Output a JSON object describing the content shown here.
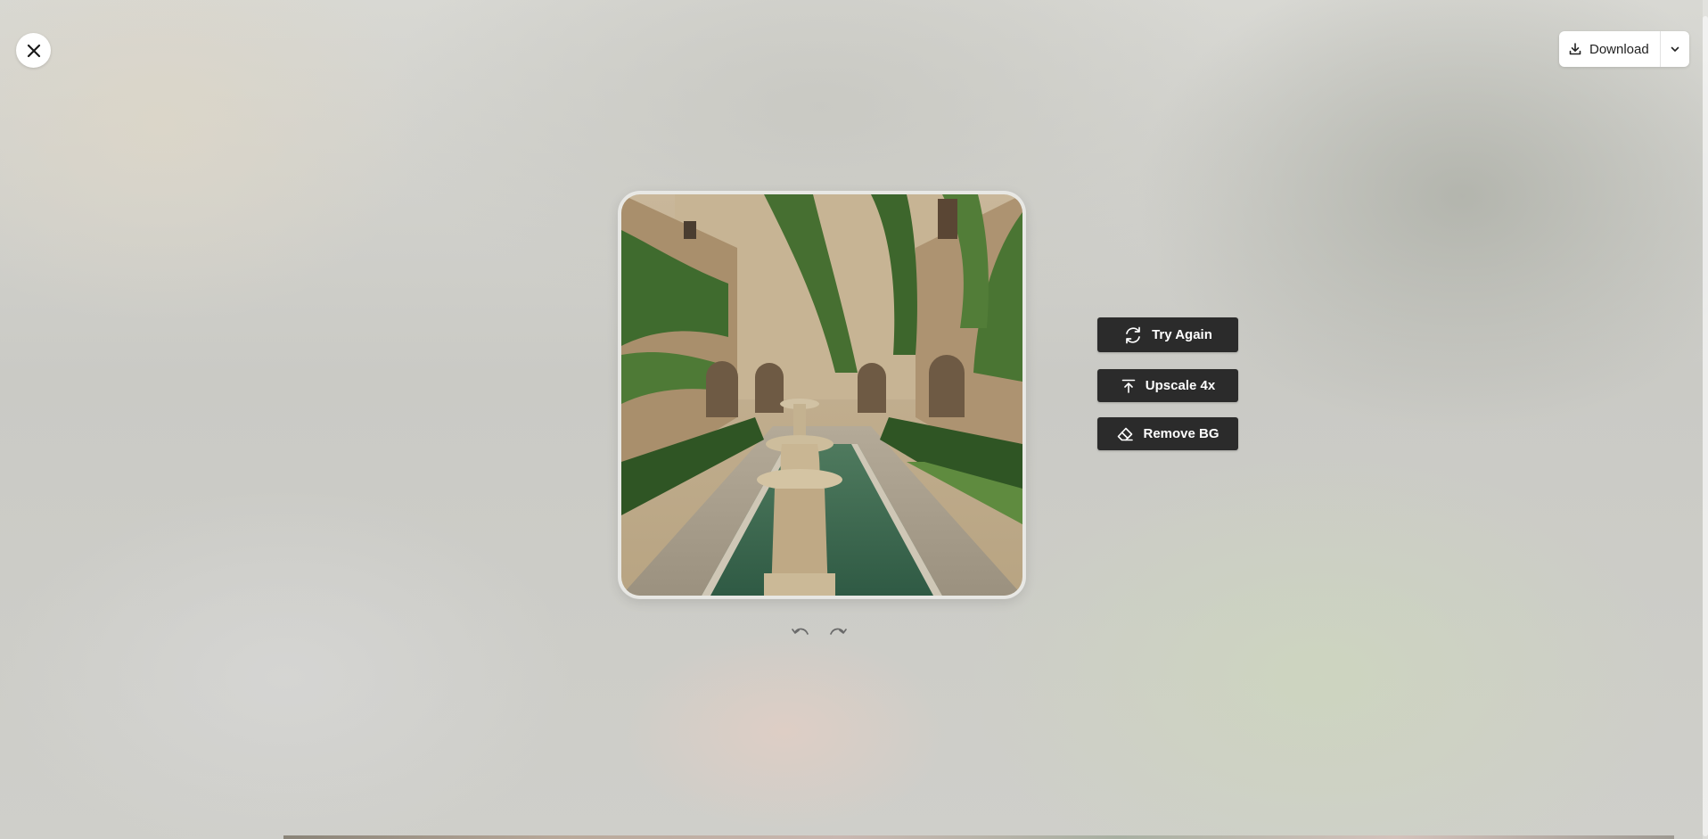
{
  "toolbar": {
    "download_label": "Download",
    "close_icon": "close-icon",
    "download_icon": "download-icon",
    "caret_icon": "chevron-down-icon"
  },
  "image": {
    "subject": "courtyard-fountain-image"
  },
  "history": {
    "undo_icon": "undo-icon",
    "redo_icon": "redo-icon"
  },
  "actions": {
    "try_again_label": "Try Again",
    "upscale_label": "Upscale 4x",
    "remove_bg_label": "Remove BG"
  },
  "colors": {
    "button_dark": "#2b2b2b",
    "button_text": "#ffffff",
    "surface": "#ffffff"
  }
}
